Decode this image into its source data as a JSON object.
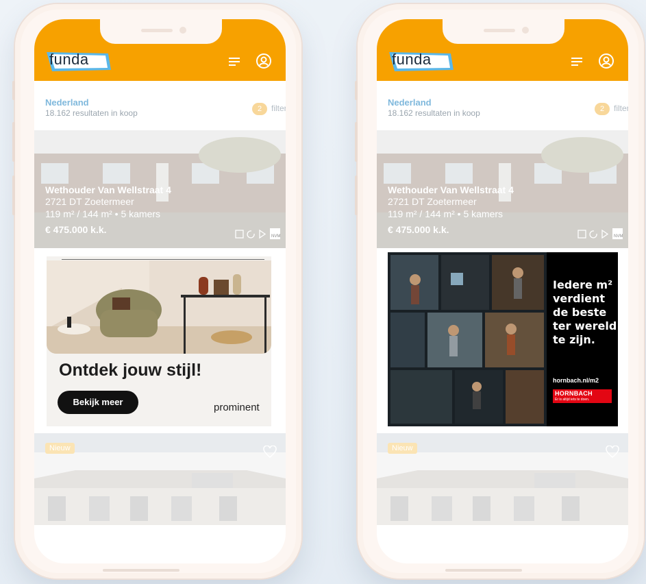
{
  "phones": [
    {
      "id": "left",
      "brand": "funda",
      "results": {
        "country": "Nederland",
        "count_text": "18.162 resultaten in koop",
        "filter_count": "2",
        "filter_label": "filters"
      },
      "listing": {
        "address": "Wethouder Van Wellstraat 4",
        "city": "2721 DT  Zoetermeer",
        "size": "119 m² / 144 m² • 5 kamers",
        "price": "€ 475.000 k.k."
      },
      "ad": {
        "type": "prominent",
        "title": "Ontdek jouw stijl!",
        "button": "Bekijk meer",
        "brand": "prominent"
      },
      "second_card": {
        "badge": "Nieuw"
      }
    },
    {
      "id": "right",
      "brand": "funda",
      "results": {
        "country": "Nederland",
        "count_text": "18.162 resultaten in koop",
        "filter_count": "2",
        "filter_label": "filters"
      },
      "listing": {
        "address": "Wethouder Van Wellstraat 4",
        "city": "2721 DT  Zoetermeer",
        "size": "119 m² / 144 m² • 5 kamers",
        "price": "€ 475.000 k.k."
      },
      "ad": {
        "type": "hornbach",
        "lines": [
          "Iedere m²",
          "verdient",
          "de beste",
          "ter wereld",
          "te zijn."
        ],
        "url": "hornbach.nl/m2",
        "logo": "HORNBACH",
        "logo_tagline": "Er is altijd iets te doen."
      },
      "second_card": {
        "badge": "Nieuw"
      }
    }
  ],
  "colors": {
    "funda_orange": "#f7a100",
    "funda_blue": "#5bb7e8",
    "hornbach_red": "#e30613"
  },
  "icons": [
    "menu-icon",
    "user-icon",
    "bookmark-icon",
    "refresh-icon",
    "play-icon",
    "nvm-icon",
    "heart-icon"
  ]
}
